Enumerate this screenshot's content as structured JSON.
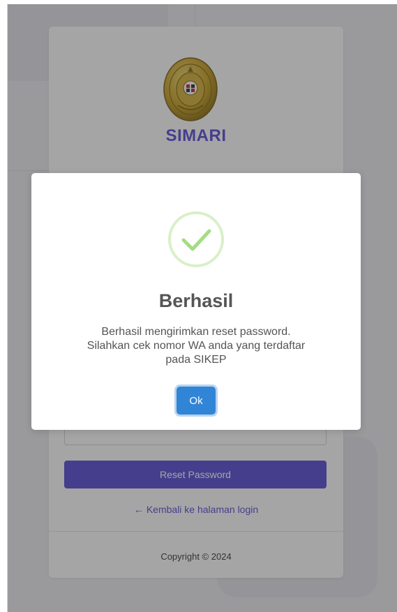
{
  "app": {
    "brand": "SIMARI"
  },
  "form": {
    "input_placeholder": "",
    "reset_label": "Reset Password",
    "back_link_arrow": "←",
    "back_link_label": "Kembali ke halaman login"
  },
  "footer": {
    "copyright": "Copyright © 2024"
  },
  "modal": {
    "icon": "success-check-icon",
    "title": "Berhasil",
    "message_lines": [
      "Berhasil mengirimkan reset password.",
      "Silahkan cek nomor WA anda yang terdaftar",
      "pada SIKEP"
    ],
    "ok_label": "Ok"
  },
  "colors": {
    "brand": "#5b4fd6",
    "ok_button": "#3085d6",
    "success": "#a5dc86",
    "emblem_gold": "#c9a227"
  }
}
